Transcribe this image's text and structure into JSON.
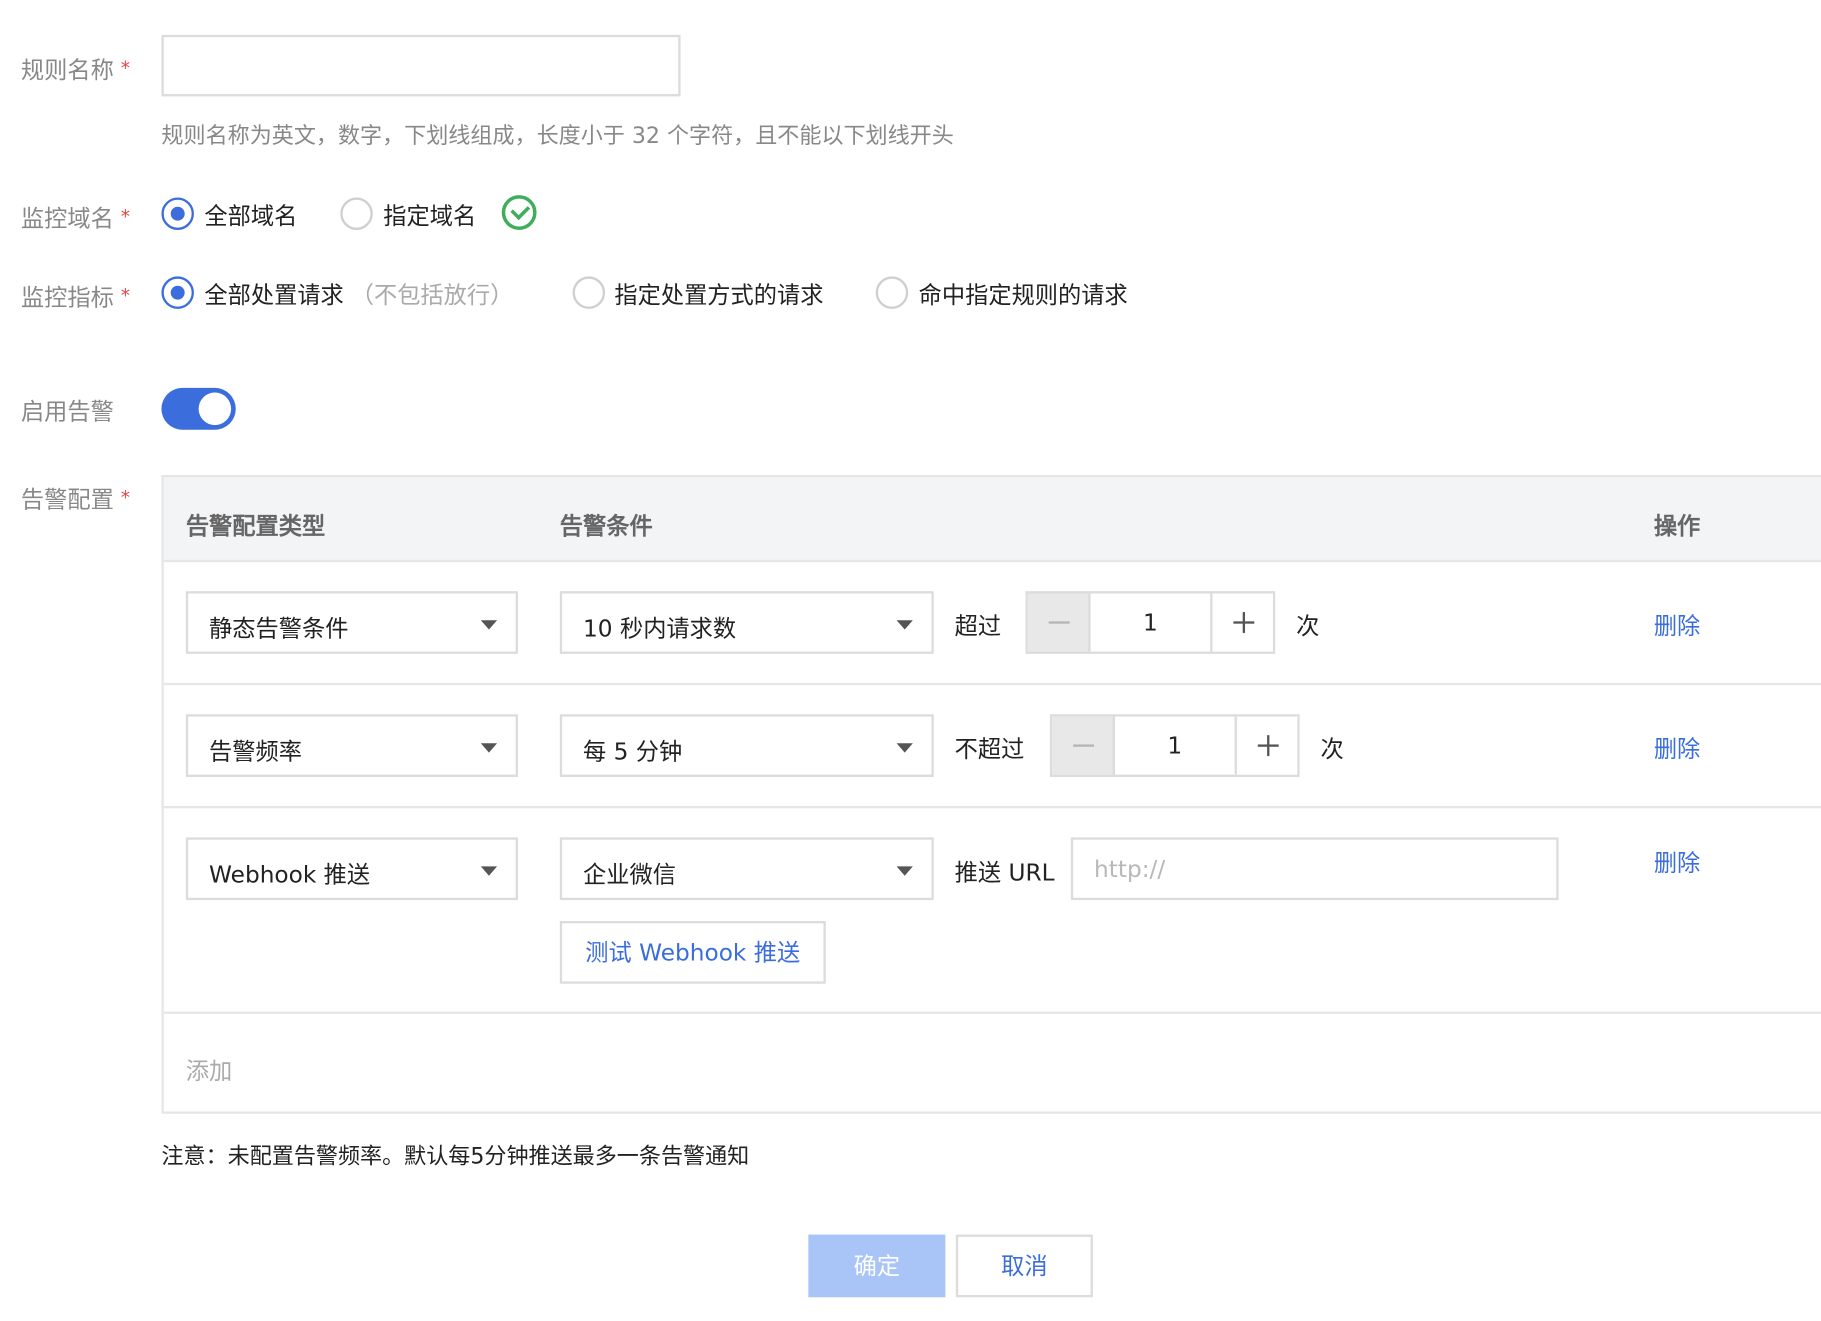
{
  "form": {
    "rule_name": {
      "label": "规则名称",
      "required_mark": "*",
      "value": "",
      "hint": "规则名称为英文，数字，下划线组成，长度小于 32 个字符，且不能以下划线开头"
    },
    "monitor_domain": {
      "label": "监控域名",
      "required_mark": "*",
      "options": [
        "全部域名",
        "指定域名"
      ],
      "selected": "全部域名",
      "status_icon": "check-circle-icon"
    },
    "monitor_metric": {
      "label": "监控指标",
      "required_mark": "*",
      "options": [
        "全部处置请求",
        "指定处置方式的请求",
        "命中指定规则的请求"
      ],
      "option0_note": "（不包括放行）",
      "selected": "全部处置请求"
    },
    "enable_alert": {
      "label": "启用告警",
      "enabled": true
    },
    "alert_config": {
      "label": "告警配置",
      "required_mark": "*",
      "columns": [
        "告警配置类型",
        "告警条件",
        "操作"
      ],
      "rows": [
        {
          "type": "静态告警条件",
          "condition": "10 秒内请求数",
          "comparator": "超过",
          "count": "1",
          "unit": "次",
          "action": "删除"
        },
        {
          "type": "告警频率",
          "condition": "每 5 分钟",
          "comparator": "不超过",
          "count": "1",
          "unit": "次",
          "action": "删除"
        },
        {
          "type": "Webhook 推送",
          "condition": "企业微信",
          "url_label": "推送 URL",
          "url_value": "",
          "url_placeholder": "http://",
          "test_button": "测试 Webhook 推送",
          "action": "删除"
        }
      ],
      "add_label": "添加"
    },
    "note": "注意：未配置告警频率。默认每5分钟推送最多一条告警通知"
  },
  "footer": {
    "confirm_label": "确定",
    "cancel_label": "取消"
  },
  "colors": {
    "accent": "#3b6ddc",
    "required": "#e54545",
    "success": "#3fae5a",
    "disabled_primary": "#a9c5f7"
  }
}
